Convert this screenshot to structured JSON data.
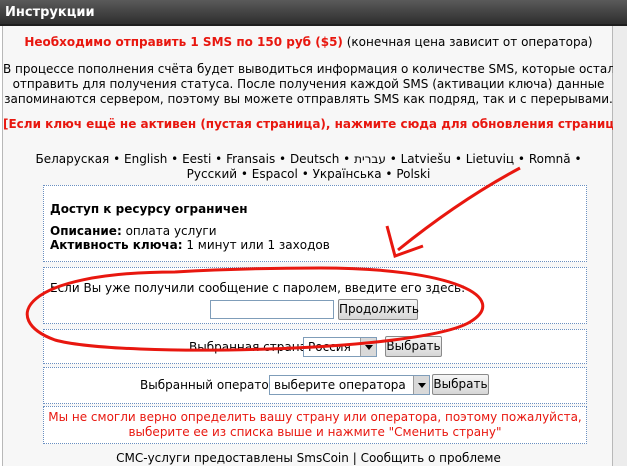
{
  "header": {
    "title": "Инструкции"
  },
  "notice": {
    "price_text": "Необходимо отправить 1 SMS по 150 руб ($5)",
    "price_note": "(конечная цена зависит от оператора)",
    "info_lines": [
      "В процессе пополнения счёта будет выводиться информация о количестве SMS, которые осталось",
      "отправить для получения статуса. После получения каждой SMS (активации ключа) данные",
      "запоминаются сервером, поэтому вы можете отправлять SMS как подряд, так и с перерывами."
    ],
    "refresh_link": "[Если ключ ещё не активен (пустая страница), нажмите сюда для обновления страницы]"
  },
  "languages": {
    "row1": [
      "Беларуская",
      "English",
      "Eesti",
      "Fransais",
      "Deutsch",
      "עברית",
      "Latviešu",
      "Lietuviц",
      "Romnă"
    ],
    "row2": [
      "Русский",
      "Espacol",
      "Українська",
      "Polski"
    ],
    "separator": "•"
  },
  "access": {
    "title": "Доступ к ресурсу ограничен",
    "description_label": "Описание:",
    "description_value": "оплата услуги",
    "activity_label": "Активность ключа:",
    "activity_value": "1 минут или 1 заходов"
  },
  "password": {
    "prompt": "Если Вы уже получили сообщение с паролем, введите его здесь:",
    "value": "",
    "continue_label": "Продолжить"
  },
  "country": {
    "label": "Выбранная страна:",
    "selected": "Россия",
    "button_label": "Выбрать"
  },
  "operator": {
    "label": "Выбранный оператор:",
    "selected": "выберите оператора",
    "button_label": "Выбрать"
  },
  "error": {
    "line1": "Мы не смогли верно определить вашу страну или оператора, поэтому пожалуйста,",
    "line2": "выберите ее из списка выше и нажмите \"Сменить страну\""
  },
  "footer": {
    "provider": "СМС-услуги предоставлены SmsCoin",
    "separator": "|",
    "report": "Сообщить о проблеме"
  },
  "colors": {
    "accent_red": "#e8170f",
    "box_border": "#6a8fc0",
    "annotation_red": "#e8170f"
  }
}
